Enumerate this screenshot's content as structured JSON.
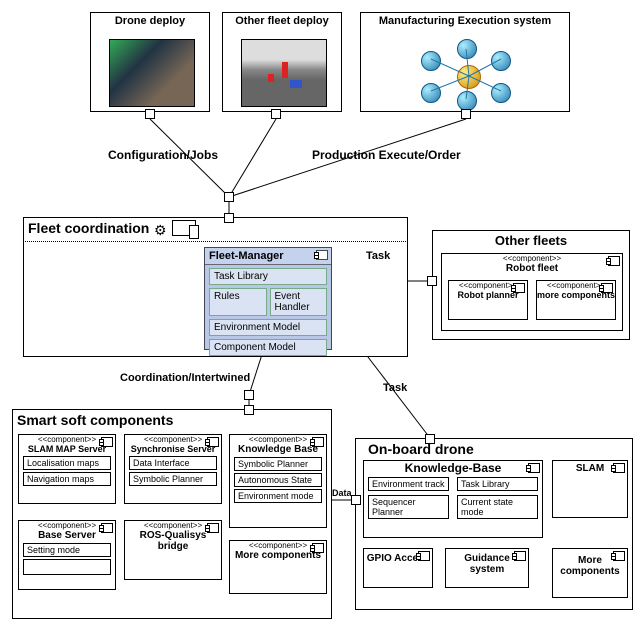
{
  "top": {
    "drone_deploy": "Drone deploy",
    "other_fleet_deploy": "Other fleet deploy",
    "mes": "Manufacturing Execution system"
  },
  "edges": {
    "config_jobs": "Configuration/Jobs",
    "prod_execute": "Production Execute/Order",
    "coord_intertwined": "Coordination/Intertwined",
    "task": "Task",
    "task2": "Task",
    "data": "Data"
  },
  "fleet_coord": {
    "title": "Fleet coordination",
    "fm_title": "Fleet-Manager",
    "task_lib": "Task Library",
    "rules": "Rules",
    "event_handler": "Event Handler",
    "env_model": "Environment Model",
    "comp_model": "Component Model"
  },
  "other_fleets": {
    "title": "Other fleets",
    "robot_fleet_stereo": "<<component>>",
    "robot_fleet": "Robot fleet",
    "robot_planner_stereo": "<<component>>",
    "robot_planner": "Robot planner",
    "more_comp_stereo": "<<component>>",
    "more_comp": "more components"
  },
  "smart": {
    "title": "Smart soft components",
    "stereo": "<<component>>",
    "slam_server": "SLAM MAP Server",
    "loc_maps": "Localisation maps",
    "nav_maps": "Navigation maps",
    "base_server": "Base Server",
    "setting_mode": "Setting mode",
    "sync_server": "Synchronise Server",
    "data_iface": "Data Interface",
    "symbolic_planner": "Symbolic Planner",
    "ros_bridge": "ROS-Qualisys bridge",
    "kb": "Knowledge Base",
    "kb_sym_planner": "Symbolic Planner",
    "kb_auto_state": "Autonomous State",
    "kb_env_mode": "Environment mode",
    "more": "More components"
  },
  "onboard": {
    "title": "On-board drone",
    "kb": "Knowledge-Base",
    "env_track": "Environment track",
    "task_lib": "Task Library",
    "seq_planner": "Sequencer Planner",
    "cur_state": "Current state mode",
    "gpio": "GPIO Access",
    "guidance": "Guidance system",
    "slam": "SLAM",
    "more": "More components"
  }
}
